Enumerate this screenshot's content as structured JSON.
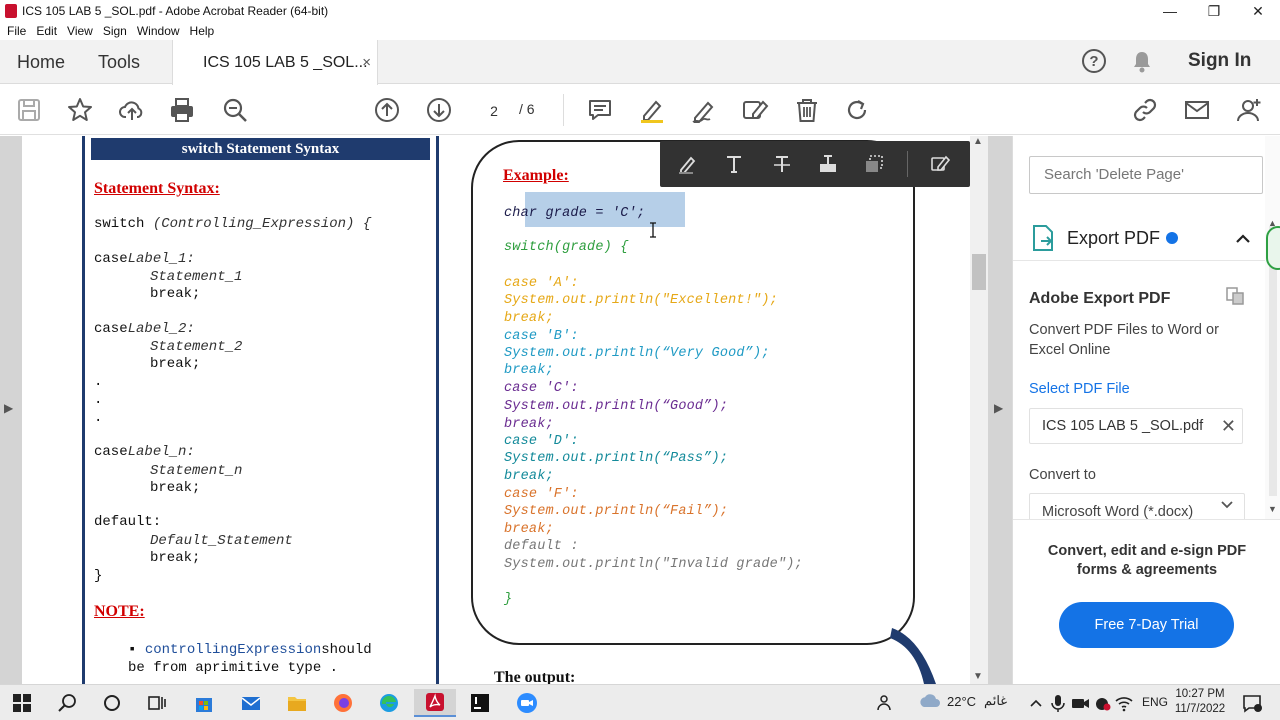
{
  "window": {
    "title": "ICS 105 LAB 5 _SOL.pdf - Adobe Acrobat Reader (64-bit)",
    "controls": {
      "minimize": "—",
      "restore": "❐",
      "close": "✕"
    }
  },
  "menu": [
    "File",
    "Edit",
    "View",
    "Sign",
    "Window",
    "Help"
  ],
  "tabs": {
    "home": "Home",
    "tools": "Tools",
    "document": "ICS 105 LAB 5 _SOL...",
    "close": "×"
  },
  "header": {
    "help": "?",
    "sign_in": "Sign In"
  },
  "toolbar": {
    "current_page": "2",
    "page_separator": "/  6"
  },
  "page_left": {
    "syntax_header": "switch Statement Syntax",
    "statement_syntax_heading": "Statement Syntax:",
    "line_switch": "switch",
    "line_switch_expr": " (Controlling_Expression) {",
    "case1_kw": "case",
    "case1_label": "Label_1:",
    "stmt1": "Statement_1",
    "break1": "break;",
    "case2_kw": "case",
    "case2_label": "Label_2:",
    "stmt2": "Statement_2",
    "break2": "break;",
    "dot1": ".",
    "dot2": ".",
    "dot3": ".",
    "casen_kw": "case",
    "casen_label": "Label_n:",
    "stmtn": "Statement_n",
    "breakn": "break;",
    "default_kw": "default:",
    "default_stmt": "Default_Statement",
    "break_default": "break;",
    "close_brace": "}",
    "note_heading": "NOTE:",
    "bullet": "▪",
    "note_expr": "controllingExpression",
    "note_should": "should",
    "note_line2": "be from aprimitive type ."
  },
  "page_right": {
    "example_heading": "Example:",
    "decl": "char grade = 'C';",
    "switch_line": "switch(grade) {",
    "case_a": "case 'A':",
    "print_a": "System.out.println(\"Excellent!\");",
    "break_a": "break;",
    "case_b": "case 'B':",
    "print_b": "System.out.println(“Very Good”);",
    "break_b": "break;",
    "case_c": "case 'C':",
    "print_c": "System.out.println(“Good”);",
    "break_c": "break;",
    "case_d": "case 'D':",
    "print_d": "System.out.println(“Pass”);",
    "break_d": "break;",
    "case_f": "case 'F':",
    "print_f": "System.out.println(“Fail”);",
    "break_f": "break;",
    "default_line": "default :",
    "print_default": "System.out.println(\"Invalid grade\");",
    "close_brace": "}",
    "output_label": "The output:"
  },
  "right_pane": {
    "search_placeholder": "Search 'Delete Page'",
    "export_pdf": "Export PDF",
    "adobe_export_title": "Adobe Export PDF",
    "adobe_export_desc": "Convert PDF Files to Word or Excel Online",
    "select_pdf_file": "Select PDF File",
    "file_name": "ICS 105 LAB 5 _SOL.pdf",
    "file_clear": "✕",
    "convert_to": "Convert to",
    "format_value": "Microsoft Word (*.docx)",
    "promo_text": "Convert, edit and e-sign PDF forms & agreements",
    "trial_button": "Free 7-Day Trial"
  },
  "taskbar": {
    "temperature": "22°C",
    "weather_text": "غائم",
    "language": "ENG",
    "time": "10:27 PM",
    "date": "11/7/2022"
  },
  "colors": {
    "navy": "#1f3b6e",
    "red_heading": "#d10000",
    "green_code": "#2e9e3e",
    "yellow_code": "#e6a817",
    "cyan_code": "#1f9ac4",
    "purple_code": "#6a2c91",
    "teal_code": "#138a9a",
    "orange_code": "#d9732b",
    "gray_code": "#777777",
    "acrobat_blue": "#1473e6"
  }
}
